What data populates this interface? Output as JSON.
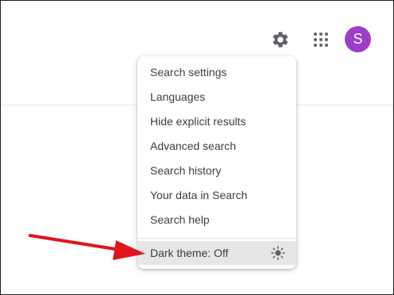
{
  "header": {
    "icons": {
      "settings": "gear-icon",
      "apps": "apps-grid-icon"
    },
    "avatar": {
      "initial": "S",
      "color": "#9c3ec9"
    }
  },
  "settings_menu": {
    "items": [
      {
        "label": "Search settings"
      },
      {
        "label": "Languages"
      },
      {
        "label": "Hide explicit results"
      },
      {
        "label": "Advanced search"
      },
      {
        "label": "Search history"
      },
      {
        "label": "Your data in Search"
      },
      {
        "label": "Search help"
      }
    ],
    "dark_theme": {
      "label": "Dark theme: Off",
      "icon": "sun-icon"
    }
  },
  "annotation": {
    "arrow_color": "#e3141c"
  }
}
